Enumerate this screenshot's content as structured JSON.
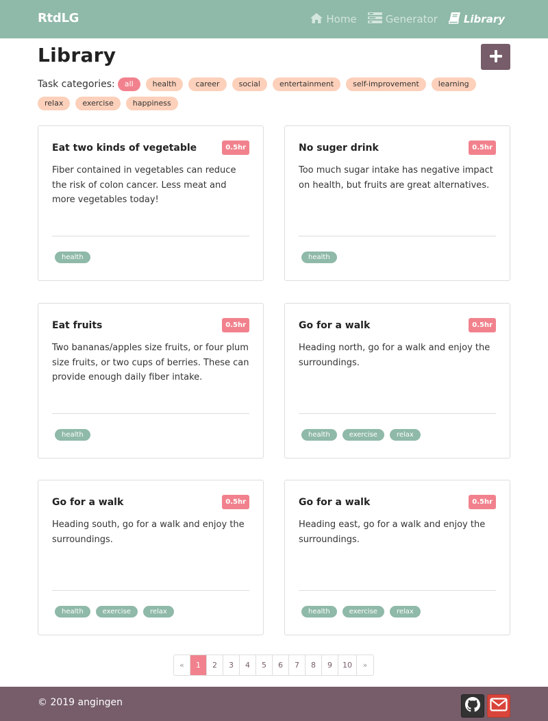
{
  "navbar": {
    "brand": "RtdLG",
    "links": [
      {
        "label": "Home",
        "icon": "home-icon"
      },
      {
        "label": "Generator",
        "icon": "generator-icon"
      },
      {
        "label": "Library",
        "icon": "book-icon",
        "active": true
      }
    ]
  },
  "header": {
    "title": "Library",
    "add_icon": "plus-icon"
  },
  "categories": {
    "label": "Task categories:",
    "items": [
      "all",
      "health",
      "career",
      "social",
      "entertainment",
      "self-improvement",
      "learning",
      "relax",
      "exercise",
      "happiness"
    ],
    "selected": "all"
  },
  "cards": [
    {
      "title": "Eat two kinds of vegetable",
      "duration": "0.5hr",
      "description": "Fiber contained in vegetables can reduce the risk of colon cancer. Less meat and more vegetables today!",
      "tags": [
        "health"
      ]
    },
    {
      "title": "No suger drink",
      "duration": "0.5hr",
      "description": "Too much sugar intake has negative impact on health, but fruits are great alternatives.",
      "tags": [
        "health"
      ]
    },
    {
      "title": "Eat fruits",
      "duration": "0.5hr",
      "description": "Two bananas/apples size fruits, or four plum size fruits, or two cups of berries. These can provide enough daily fiber intake.",
      "tags": [
        "health"
      ]
    },
    {
      "title": "Go for a walk",
      "duration": "0.5hr",
      "description": "Heading north, go for a walk and enjoy the surroundings.",
      "tags": [
        "health",
        "exercise",
        "relax"
      ]
    },
    {
      "title": "Go for a walk",
      "duration": "0.5hr",
      "description": "Heading south, go for a walk and enjoy the surroundings.",
      "tags": [
        "health",
        "exercise",
        "relax"
      ]
    },
    {
      "title": "Go for a walk",
      "duration": "0.5hr",
      "description": "Heading east, go for a walk and enjoy the surroundings.",
      "tags": [
        "health",
        "exercise",
        "relax"
      ]
    }
  ],
  "pagination": {
    "prev": "«",
    "pages": [
      "1",
      "2",
      "3",
      "4",
      "5",
      "6",
      "7",
      "8",
      "9",
      "10"
    ],
    "current": "1",
    "next": "»"
  },
  "footer": {
    "copyright": "© 2019 angingen",
    "social": [
      {
        "icon": "github-icon"
      },
      {
        "icon": "mail-icon"
      }
    ]
  },
  "colors": {
    "primary": "#8fb9a8",
    "accent": "#f1828d",
    "category": "#fcd0ba",
    "dark": "#765d69"
  }
}
